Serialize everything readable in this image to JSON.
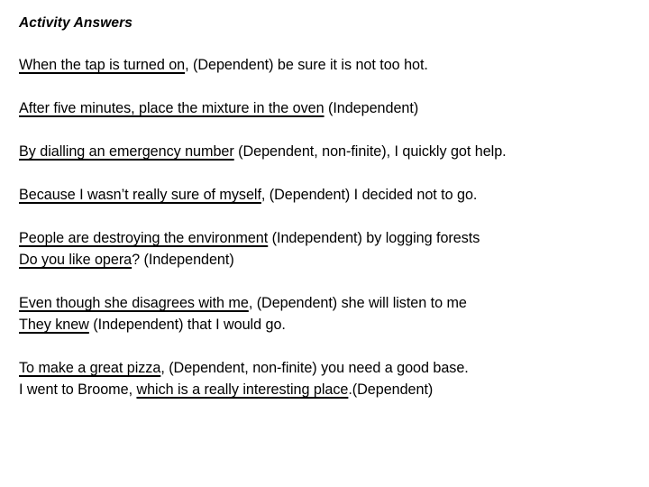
{
  "document": {
    "title": "Activity Answers",
    "background_color": "#ffffff",
    "text_color": "#000000",
    "paragraphs": [
      {
        "id": "answer-1",
        "lines": [
          {
            "segments": [
              {
                "text": "When the tap is turned on",
                "underlined": true
              },
              {
                "text": ", (Dependent) be sure it is not too hot.",
                "underlined": false
              }
            ]
          }
        ]
      },
      {
        "id": "answer-2",
        "lines": [
          {
            "segments": [
              {
                "text": "After five minutes, place the mixture in the oven",
                "underlined": true
              },
              {
                "text": " (Independent)",
                "underlined": false
              }
            ]
          }
        ]
      },
      {
        "id": "answer-3",
        "lines": [
          {
            "segments": [
              {
                "text": "By dialling an emergency number",
                "underlined": true
              },
              {
                "text": " (Dependent, non-finite), I quickly got help.",
                "underlined": false
              }
            ]
          }
        ]
      },
      {
        "id": "answer-4",
        "lines": [
          {
            "segments": [
              {
                "text": "Because I wasn’t really sure of myself",
                "underlined": true
              },
              {
                "text": ", (Dependent) I decided not to go.",
                "underlined": false
              }
            ]
          }
        ]
      },
      {
        "id": "answer-5",
        "lines": [
          {
            "segments": [
              {
                "text": "People are destroying the environment",
                "underlined": true
              },
              {
                "text": " (Independent) by logging forests",
                "underlined": false
              }
            ]
          },
          {
            "segments": [
              {
                "text": "Do you like opera",
                "underlined": true
              },
              {
                "text": "? (Independent)",
                "underlined": false
              }
            ]
          }
        ]
      },
      {
        "id": "answer-6",
        "lines": [
          {
            "segments": [
              {
                "text": "Even though she disagrees with me",
                "underlined": true
              },
              {
                "text": ", (Dependent) she will listen to me",
                "underlined": false
              }
            ]
          },
          {
            "segments": [
              {
                "text": "They knew",
                "underlined": true
              },
              {
                "text": " (Independent) that I would go.",
                "underlined": false
              }
            ]
          }
        ]
      },
      {
        "id": "answer-7",
        "lines": [
          {
            "segments": [
              {
                "text": "To make a great pizza",
                "underlined": true
              },
              {
                "text": ", (Dependent, non-finite) you need a good base.",
                "underlined": false
              }
            ]
          },
          {
            "segments": [
              {
                "text": "I went to Broome, ",
                "underlined": false
              },
              {
                "text": "which is a really interesting place",
                "underlined": true
              },
              {
                "text": ".(Dependent)",
                "underlined": false
              }
            ]
          }
        ]
      }
    ]
  }
}
